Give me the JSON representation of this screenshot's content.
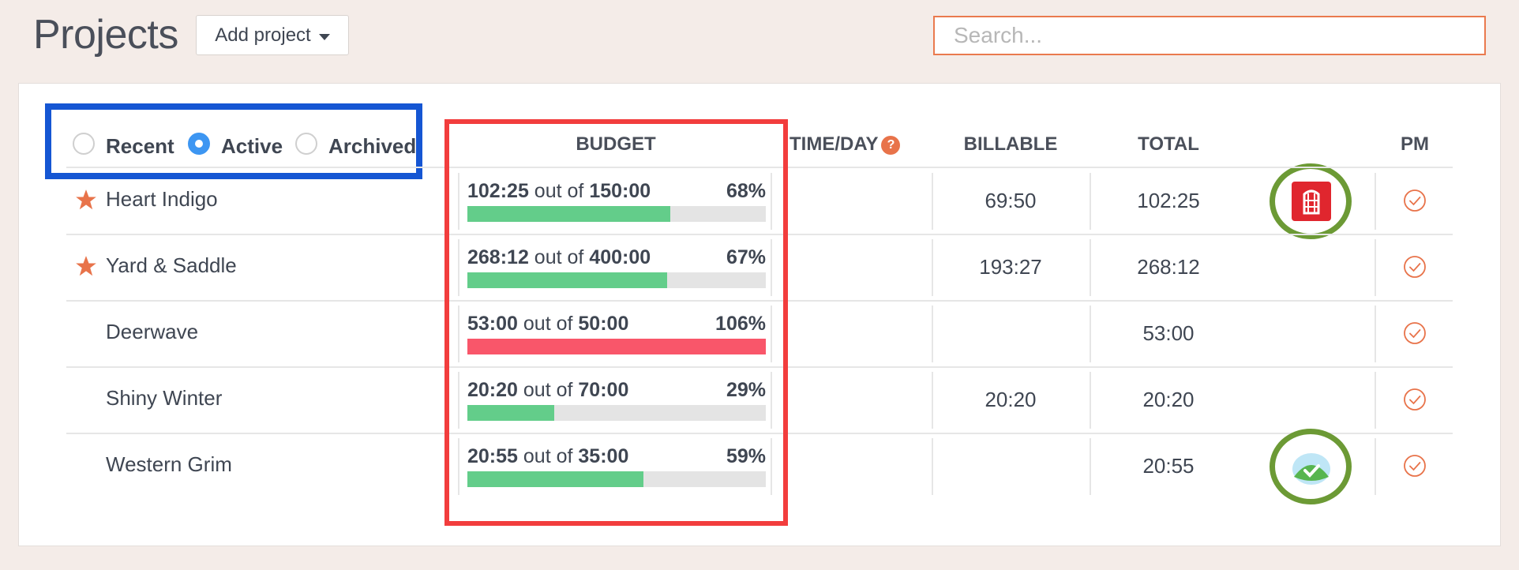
{
  "header": {
    "title": "Projects",
    "add_project_label": "Add project",
    "search_placeholder": "Search..."
  },
  "filters": [
    {
      "label": "Recent",
      "checked": false
    },
    {
      "label": "Active",
      "checked": true
    },
    {
      "label": "Archived",
      "checked": false
    }
  ],
  "columns": {
    "budget": "BUDGET",
    "time_per_day": "TIME/DAY",
    "help_glyph": "?",
    "billable": "BILLABLE",
    "total": "TOTAL",
    "pm": "PM"
  },
  "budget_joiner": "out of",
  "projects": [
    {
      "starred": true,
      "name": "Heart Indigo",
      "spent": "102:25",
      "budget": "150:00",
      "pct": "68%",
      "fill": 0.68,
      "billable": "69:50",
      "total": "102:25",
      "app_icon": "building-icon"
    },
    {
      "starred": true,
      "name": "Yard & Saddle",
      "spent": "268:12",
      "budget": "400:00",
      "pct": "67%",
      "fill": 0.67,
      "billable": "193:27",
      "total": "268:12",
      "app_icon": ""
    },
    {
      "starred": false,
      "name": "Deerwave",
      "spent": "53:00",
      "budget": "50:00",
      "pct": "106%",
      "fill": 1.0,
      "billable": "",
      "total": "53:00",
      "app_icon": ""
    },
    {
      "starred": false,
      "name": "Shiny Winter",
      "spent": "20:20",
      "budget": "70:00",
      "pct": "29%",
      "fill": 0.29,
      "billable": "20:20",
      "total": "20:20",
      "app_icon": ""
    },
    {
      "starred": false,
      "name": "Western Grim",
      "spent": "20:55",
      "budget": "35:00",
      "pct": "59%",
      "fill": 0.59,
      "billable": "",
      "total": "20:55",
      "app_icon": "basecamp-icon"
    }
  ],
  "colors": {
    "accent": "#e8734a",
    "progress_ok": "#63cd8a",
    "progress_over": "#f9566a",
    "radio_checked": "#3d96f2",
    "annotation_blue": "#1556d3",
    "annotation_red": "#f23d3d",
    "annotation_green": "#6c9a35"
  }
}
